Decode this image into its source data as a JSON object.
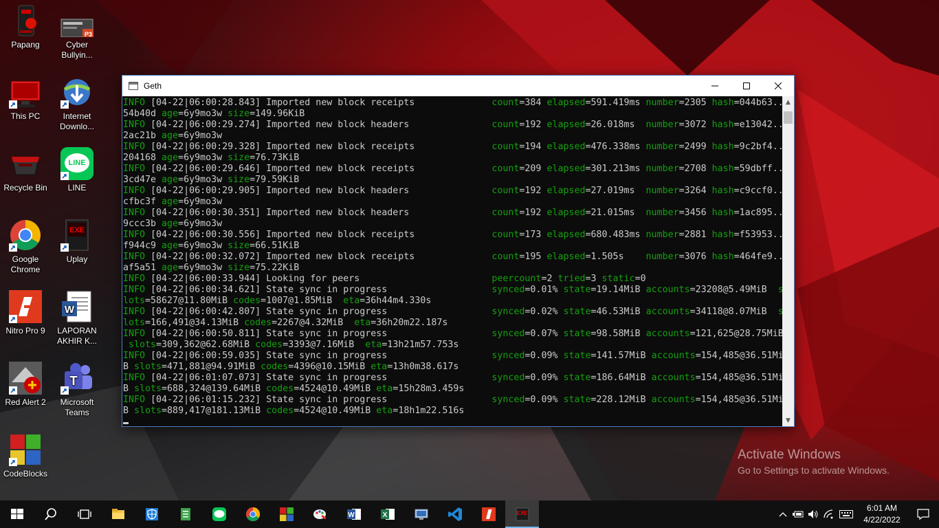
{
  "desktop": {
    "icons": [
      {
        "label": "Papang"
      },
      {
        "label": "Cyber Bullyin..."
      },
      {
        "label": "This PC"
      },
      {
        "label": "Internet Downlo..."
      },
      {
        "label": "Recycle Bin"
      },
      {
        "label": "LINE"
      },
      {
        "label": "Google Chrome"
      },
      {
        "label": "Uplay"
      },
      {
        "label": "Nitro Pro 9"
      },
      {
        "label": "LAPORAN AKHIR K..."
      },
      {
        "label": "Red Alert 2"
      },
      {
        "label": "Microsoft Teams"
      },
      {
        "label": "CodeBlocks"
      }
    ],
    "cyber_icon_badge": "P3",
    "uplay_icon_text": "EXE",
    "line_icon_text": "LINE"
  },
  "window": {
    "title": "Geth",
    "lines": [
      {
        "pre": "INFO",
        "t": " [04-22|06:00:28.843] Imported new block receipts              ",
        "kv": [
          [
            "count",
            "=384 "
          ],
          [
            "elapsed",
            "=591.419ms "
          ],
          [
            "number",
            "=2305 "
          ],
          [
            "hash",
            "=044b63.."
          ]
        ]
      },
      {
        "pre": "",
        "t": "54b40d ",
        "kv": [
          [
            "age",
            "=6y9mo3w "
          ],
          [
            "size",
            "=149.96KiB"
          ]
        ]
      },
      {
        "pre": "INFO",
        "t": " [04-22|06:00:29.274] Imported new block headers               ",
        "kv": [
          [
            "count",
            "=192 "
          ],
          [
            "elapsed",
            "=26.018ms  "
          ],
          [
            "number",
            "=3072 "
          ],
          [
            "hash",
            "=e13042.."
          ]
        ]
      },
      {
        "pre": "",
        "t": "2ac21b ",
        "kv": [
          [
            "age",
            "=6y9mo3w"
          ]
        ]
      },
      {
        "pre": "INFO",
        "t": " [04-22|06:00:29.328] Imported new block receipts              ",
        "kv": [
          [
            "count",
            "=194 "
          ],
          [
            "elapsed",
            "=476.338ms "
          ],
          [
            "number",
            "=2499 "
          ],
          [
            "hash",
            "=9c2bf4.."
          ]
        ]
      },
      {
        "pre": "",
        "t": "204168 ",
        "kv": [
          [
            "age",
            "=6y9mo3w "
          ],
          [
            "size",
            "=76.73KiB"
          ]
        ]
      },
      {
        "pre": "INFO",
        "t": " [04-22|06:00:29.646] Imported new block receipts              ",
        "kv": [
          [
            "count",
            "=209 "
          ],
          [
            "elapsed",
            "=301.213ms "
          ],
          [
            "number",
            "=2708 "
          ],
          [
            "hash",
            "=59dbff.."
          ]
        ]
      },
      {
        "pre": "",
        "t": "3cd47e ",
        "kv": [
          [
            "age",
            "=6y9mo3w "
          ],
          [
            "size",
            "=79.59KiB"
          ]
        ]
      },
      {
        "pre": "INFO",
        "t": " [04-22|06:00:29.905] Imported new block headers               ",
        "kv": [
          [
            "count",
            "=192 "
          ],
          [
            "elapsed",
            "=27.019ms  "
          ],
          [
            "number",
            "=3264 "
          ],
          [
            "hash",
            "=c9ccf0.."
          ]
        ]
      },
      {
        "pre": "",
        "t": "cfbc3f ",
        "kv": [
          [
            "age",
            "=6y9mo3w"
          ]
        ]
      },
      {
        "pre": "INFO",
        "t": " [04-22|06:00:30.351] Imported new block headers               ",
        "kv": [
          [
            "count",
            "=192 "
          ],
          [
            "elapsed",
            "=21.015ms  "
          ],
          [
            "number",
            "=3456 "
          ],
          [
            "hash",
            "=1ac895.."
          ]
        ]
      },
      {
        "pre": "",
        "t": "9ccc3b ",
        "kv": [
          [
            "age",
            "=6y9mo3w"
          ]
        ]
      },
      {
        "pre": "INFO",
        "t": " [04-22|06:00:30.556] Imported new block receipts              ",
        "kv": [
          [
            "count",
            "=173 "
          ],
          [
            "elapsed",
            "=680.483ms "
          ],
          [
            "number",
            "=2881 "
          ],
          [
            "hash",
            "=f53953.."
          ]
        ]
      },
      {
        "pre": "",
        "t": "f944c9 ",
        "kv": [
          [
            "age",
            "=6y9mo3w "
          ],
          [
            "size",
            "=66.51KiB"
          ]
        ]
      },
      {
        "pre": "INFO",
        "t": " [04-22|06:00:32.072] Imported new block receipts              ",
        "kv": [
          [
            "count",
            "=195 "
          ],
          [
            "elapsed",
            "=1.505s    "
          ],
          [
            "number",
            "=3076 "
          ],
          [
            "hash",
            "=464fe9.."
          ]
        ]
      },
      {
        "pre": "",
        "t": "af5a51 ",
        "kv": [
          [
            "age",
            "=6y9mo3w "
          ],
          [
            "size",
            "=75.22KiB"
          ]
        ]
      },
      {
        "pre": "INFO",
        "t": " [04-22|06:00:33.944] Looking for peers                        ",
        "kv": [
          [
            "peercount",
            "=2 "
          ],
          [
            "tried",
            "=3 "
          ],
          [
            "static",
            "=0"
          ]
        ]
      },
      {
        "pre": "INFO",
        "t": " [04-22|06:00:34.621] State sync in progress                   ",
        "kv": [
          [
            "synced",
            "=0.01% "
          ],
          [
            "state",
            "=19.14MiB "
          ],
          [
            "accounts",
            "=23208@5.49MiB  "
          ],
          [
            "s",
            ""
          ]
        ]
      },
      {
        "pre": "",
        "t": "",
        "kv": [
          [
            "lots",
            "=58627@11.80MiB "
          ],
          [
            "codes",
            "=1007@1.85MiB  "
          ],
          [
            "eta",
            "=36h44m4.330s"
          ]
        ]
      },
      {
        "pre": "INFO",
        "t": " [04-22|06:00:42.807] State sync in progress                   ",
        "kv": [
          [
            "synced",
            "=0.02% "
          ],
          [
            "state",
            "=46.53MiB "
          ],
          [
            "accounts",
            "=34118@8.07MiB  "
          ],
          [
            "s",
            ""
          ]
        ]
      },
      {
        "pre": "",
        "t": "",
        "kv": [
          [
            "lots",
            "=166,491@34.13MiB "
          ],
          [
            "codes",
            "=2267@4.32MiB  "
          ],
          [
            "eta",
            "=36h20m22.187s"
          ]
        ]
      },
      {
        "pre": "INFO",
        "t": " [04-22|06:00:50.811] State sync in progress                   ",
        "kv": [
          [
            "synced",
            "=0.07% "
          ],
          [
            "state",
            "=98.58MiB "
          ],
          [
            "accounts",
            "=121,625@28.75MiB"
          ]
        ]
      },
      {
        "pre": "",
        "t": " ",
        "kv": [
          [
            "slots",
            "=309,362@62.68MiB "
          ],
          [
            "codes",
            "=3393@7.16MiB  "
          ],
          [
            "eta",
            "=13h21m57.753s"
          ]
        ]
      },
      {
        "pre": "INFO",
        "t": " [04-22|06:00:59.035] State sync in progress                   ",
        "kv": [
          [
            "synced",
            "=0.09% "
          ],
          [
            "state",
            "=141.57MiB "
          ],
          [
            "accounts",
            "=154,485@36.51Mi"
          ]
        ]
      },
      {
        "pre": "",
        "t": "B ",
        "kv": [
          [
            "slots",
            "=471,881@94.91MiB "
          ],
          [
            "codes",
            "=4396@10.15MiB "
          ],
          [
            "eta",
            "=13h0m38.617s"
          ]
        ]
      },
      {
        "pre": "INFO",
        "t": " [04-22|06:01:07.073] State sync in progress                   ",
        "kv": [
          [
            "synced",
            "=0.09% "
          ],
          [
            "state",
            "=186.64MiB "
          ],
          [
            "accounts",
            "=154,485@36.51Mi"
          ]
        ]
      },
      {
        "pre": "",
        "t": "B ",
        "kv": [
          [
            "slots",
            "=688,324@139.64MiB "
          ],
          [
            "codes",
            "=4524@10.49MiB "
          ],
          [
            "eta",
            "=15h28m3.459s"
          ]
        ]
      },
      {
        "pre": "INFO",
        "t": " [04-22|06:01:15.232] State sync in progress                   ",
        "kv": [
          [
            "synced",
            "=0.09% "
          ],
          [
            "state",
            "=228.12MiB "
          ],
          [
            "accounts",
            "=154,485@36.51Mi"
          ]
        ]
      },
      {
        "pre": "",
        "t": "B ",
        "kv": [
          [
            "slots",
            "=889,417@181.13MiB "
          ],
          [
            "codes",
            "=4524@10.49MiB "
          ],
          [
            "eta",
            "=18h1m22.516s"
          ]
        ]
      }
    ]
  },
  "watermark": {
    "line1": "Activate Windows",
    "line2": "Go to Settings to activate Windows."
  },
  "taskbar": {
    "time": "6:01 AM",
    "date": "4/22/2022",
    "apps": [
      "file-explorer",
      "windows-security",
      "notepad",
      "line",
      "chrome",
      "codeblocks",
      "paint",
      "word",
      "excel",
      "remote-desktop",
      "vscode",
      "nitro-pro",
      "geth-exe"
    ],
    "exe_badge": "EXE"
  },
  "colors": {
    "console_green": "#13a10e",
    "console_text": "#cccccc",
    "window_border": "#4a7fc1"
  }
}
